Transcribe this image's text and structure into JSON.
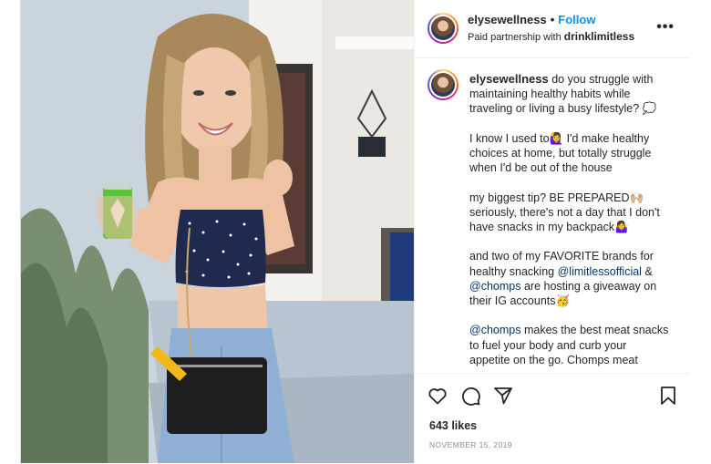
{
  "header": {
    "username": "elysewellness",
    "separator": "•",
    "follow_label": "Follow",
    "partnership_prefix": "Paid partnership with",
    "partner": "drinklimitless",
    "more_label": "•••"
  },
  "caption": {
    "username": "elysewellness",
    "p1": "do you struggle with maintaining healthy habits while traveling or living a busy lifestyle? 💭",
    "p2": "I know I used to🙋‍♀️ I'd make healthy choices at home, but totally struggle when I'd be out of the house",
    "p3": "my biggest tip? BE PREPARED🙌🏼 seriously, there's not a day that I don't have snacks in my backpack🤷‍♀️",
    "p4_a": "and two of my FAVORITE brands for healthy snacking",
    "p4_mention1": "@limitlessofficial",
    "p4_b": "&",
    "p4_mention2": "@chomps",
    "p4_c": "are hosting a giveaway on their IG accounts🥳",
    "p5_mention": "@chomps",
    "p5_text": "makes the best meat snacks to fuel your body and curb your appetite on the go. Chomps meat"
  },
  "actions": {
    "likes": "643 likes",
    "date": "NOVEMBER 15, 2019"
  },
  "icons": {
    "like": "heart-icon",
    "comment": "comment-icon",
    "share": "send-icon",
    "save": "bookmark-icon"
  },
  "colors": {
    "accent": "#0095f6",
    "mention": "#00376b",
    "muted": "#8e8e8e"
  }
}
